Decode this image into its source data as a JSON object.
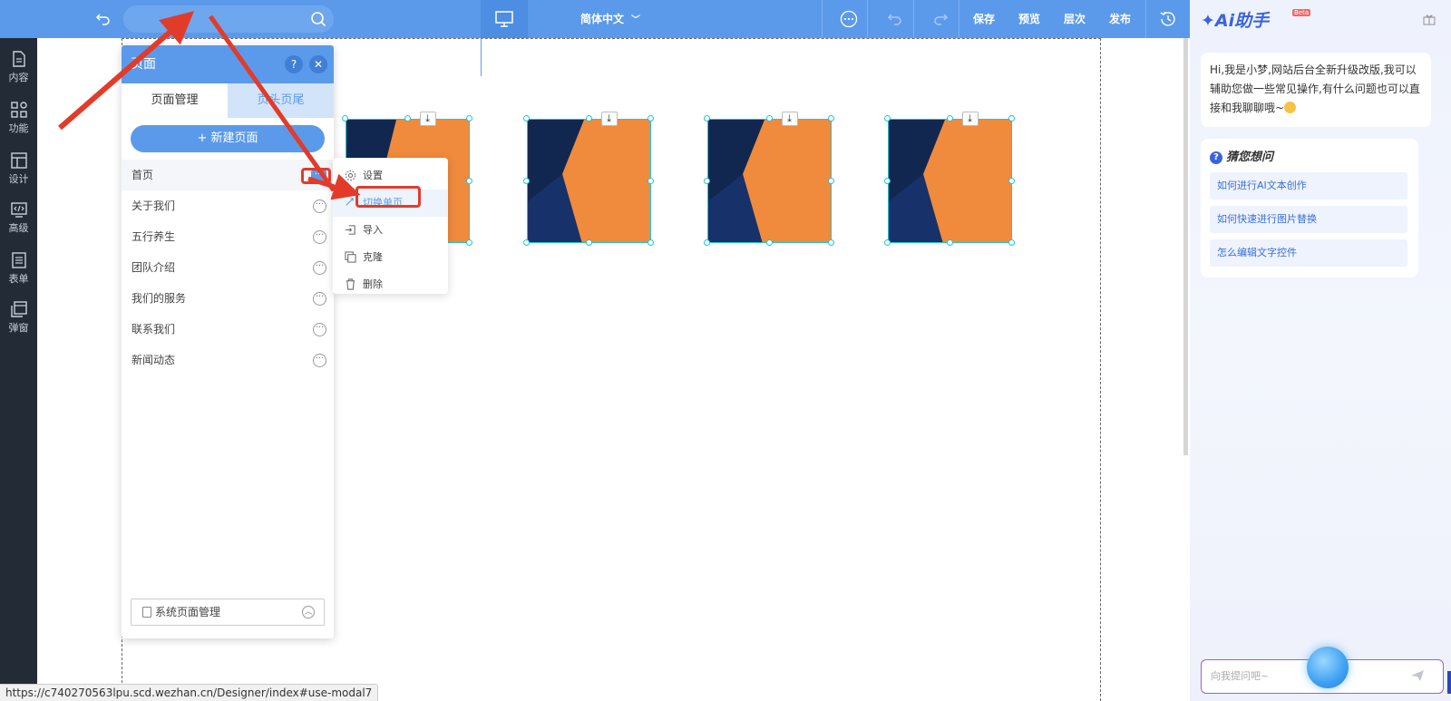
{
  "toolbar": {
    "language": "简体中文",
    "save": "保存",
    "preview": "预览",
    "layers": "层次",
    "publish": "发布"
  },
  "sidebar": {
    "items": [
      {
        "label": "内容",
        "icon": "document-icon"
      },
      {
        "label": "功能",
        "icon": "grid-icon"
      },
      {
        "label": "设计",
        "icon": "layout-icon"
      },
      {
        "label": "高级",
        "icon": "code-icon"
      },
      {
        "label": "表单",
        "icon": "form-icon"
      },
      {
        "label": "弹窗",
        "icon": "popup-icon"
      }
    ]
  },
  "page_panel": {
    "title": "页面",
    "tabs": [
      "页面管理",
      "页头页尾"
    ],
    "new_page": "+ 新建页面",
    "pages": [
      "首页",
      "关于我们",
      "五行养生",
      "团队介绍",
      "我们的服务",
      "联系我们",
      "新闻动态"
    ],
    "system_manager": "系统页面管理"
  },
  "context_menu": {
    "items": [
      {
        "label": "设置",
        "icon": "gear-icon"
      },
      {
        "label": "切换单页",
        "icon": "switch-icon"
      },
      {
        "label": "导入",
        "icon": "import-icon"
      },
      {
        "label": "克隆",
        "icon": "clone-icon"
      },
      {
        "label": "删除",
        "icon": "trash-icon"
      }
    ],
    "highlighted": "切换单页"
  },
  "ai_assistant": {
    "title": "Ai助手",
    "badge": "Beta",
    "greeting": "Hi,我是小梦,网站后台全新升级改版,我可以辅助您做一些常见操作,有什么问题也可以直接和我聊聊哦~",
    "guess_title": "猜您想问",
    "suggestions": [
      "如何进行AI文本创作",
      "如何快速进行图片替换",
      "怎么编辑文字控件"
    ],
    "input_placeholder": "向我提问吧~"
  },
  "status_bar": {
    "url": "https://c740270563lpu.scd.wezhan.cn/Designer/index#use-modal7"
  },
  "colors": {
    "primary": "#5b9aea",
    "sidebar_bg": "#222b36",
    "annotation_red": "#e23b2a",
    "selection_cyan": "#21c5d8",
    "image_orange": "#f08a3c",
    "image_navy": "#122750"
  }
}
